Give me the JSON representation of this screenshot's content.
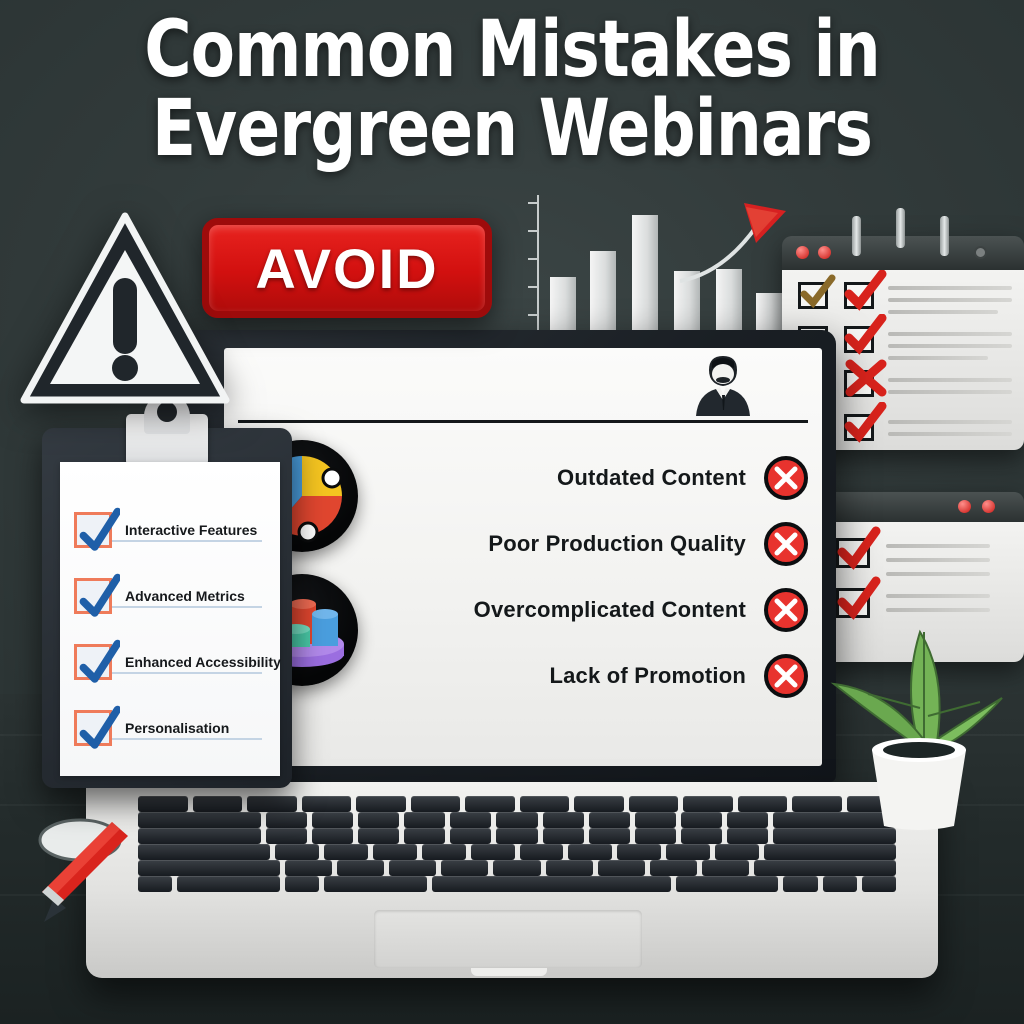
{
  "title": {
    "line1": "Common Mistakes in",
    "line2": "Evergreen Webinars"
  },
  "badge": {
    "label": "AVOID"
  },
  "colors": {
    "background": "#2f3838",
    "badge_red": "#d2100f",
    "x_red": "#e8332e",
    "check_blue": "#1f5fa8",
    "checkbox_orange": "#ef7b5a",
    "laptop_body": "#f2f2f0",
    "laptop_bezel": "#1a1f24",
    "screen_white": "#f7f7f5",
    "plant_green": "#6aa84f",
    "pen_red": "#d9241d",
    "pie_blue": "#4a9ede",
    "pie_yellow": "#f4c420",
    "pie_red": "#e0462f",
    "bar_purple": "#9b6ee0",
    "bar_teal": "#49c9a7"
  },
  "clipboard": {
    "name": "benefits-checklist",
    "items": [
      {
        "label": "Interactive Features",
        "checked": true
      },
      {
        "label": "Advanced Metrics",
        "checked": true
      },
      {
        "label": "Enhanced Accessibility",
        "checked": true
      },
      {
        "label": "Personalisation",
        "checked": true
      }
    ]
  },
  "screen": {
    "avatar": "presenter-silhouette-icon",
    "icons": [
      {
        "name": "pie-chart-icon",
        "slices": [
          {
            "color": "#4a9ede",
            "label": "blue-slice"
          },
          {
            "color": "#f4c420",
            "label": "yellow-slice"
          },
          {
            "color": "#e0462f",
            "label": "red-slice"
          }
        ]
      },
      {
        "name": "bar-chart-3d-icon",
        "bars": [
          {
            "color": "#e0462f"
          },
          {
            "color": "#4a9ede"
          },
          {
            "color": "#f4c420"
          },
          {
            "color": "#49c9a7"
          }
        ],
        "platform_color": "#9b6ee0"
      }
    ],
    "mistakes": [
      {
        "label": "Outdated Content",
        "marker": "x-circle-icon"
      },
      {
        "label": "Poor Production Quality",
        "marker": "x-circle-icon"
      },
      {
        "label": "Overcomplicated Content",
        "marker": "x-circle-icon"
      },
      {
        "label": "Lack of Promotion",
        "marker": "x-circle-icon"
      }
    ]
  },
  "chart_data": {
    "type": "bar",
    "title": "",
    "xlabel": "",
    "ylabel": "",
    "categories": [
      "1",
      "2",
      "3",
      "4",
      "5",
      "6"
    ],
    "values": [
      52,
      72,
      100,
      58,
      60,
      38
    ],
    "ylim": [
      0,
      100
    ],
    "grid": false,
    "legend": "none",
    "annotations": [
      {
        "type": "arrow",
        "label": "upward-trend-arrow",
        "color": "#e02020"
      }
    ],
    "axis_ticks": 5
  },
  "panels": {
    "top_panel": {
      "name": "checklist-window-top",
      "checkmarks": 5,
      "text_lines": 9,
      "window_dots": 2,
      "spiral_rings": 3
    },
    "bottom_panel": {
      "name": "checklist-window-bottom",
      "checkmarks": 2,
      "text_lines": 5,
      "window_dots": 2
    }
  },
  "decor": {
    "warning_icon": "warning-triangle-icon",
    "plant": "potted-plant",
    "pen": "red-pen",
    "keyboard_rows": 6
  }
}
